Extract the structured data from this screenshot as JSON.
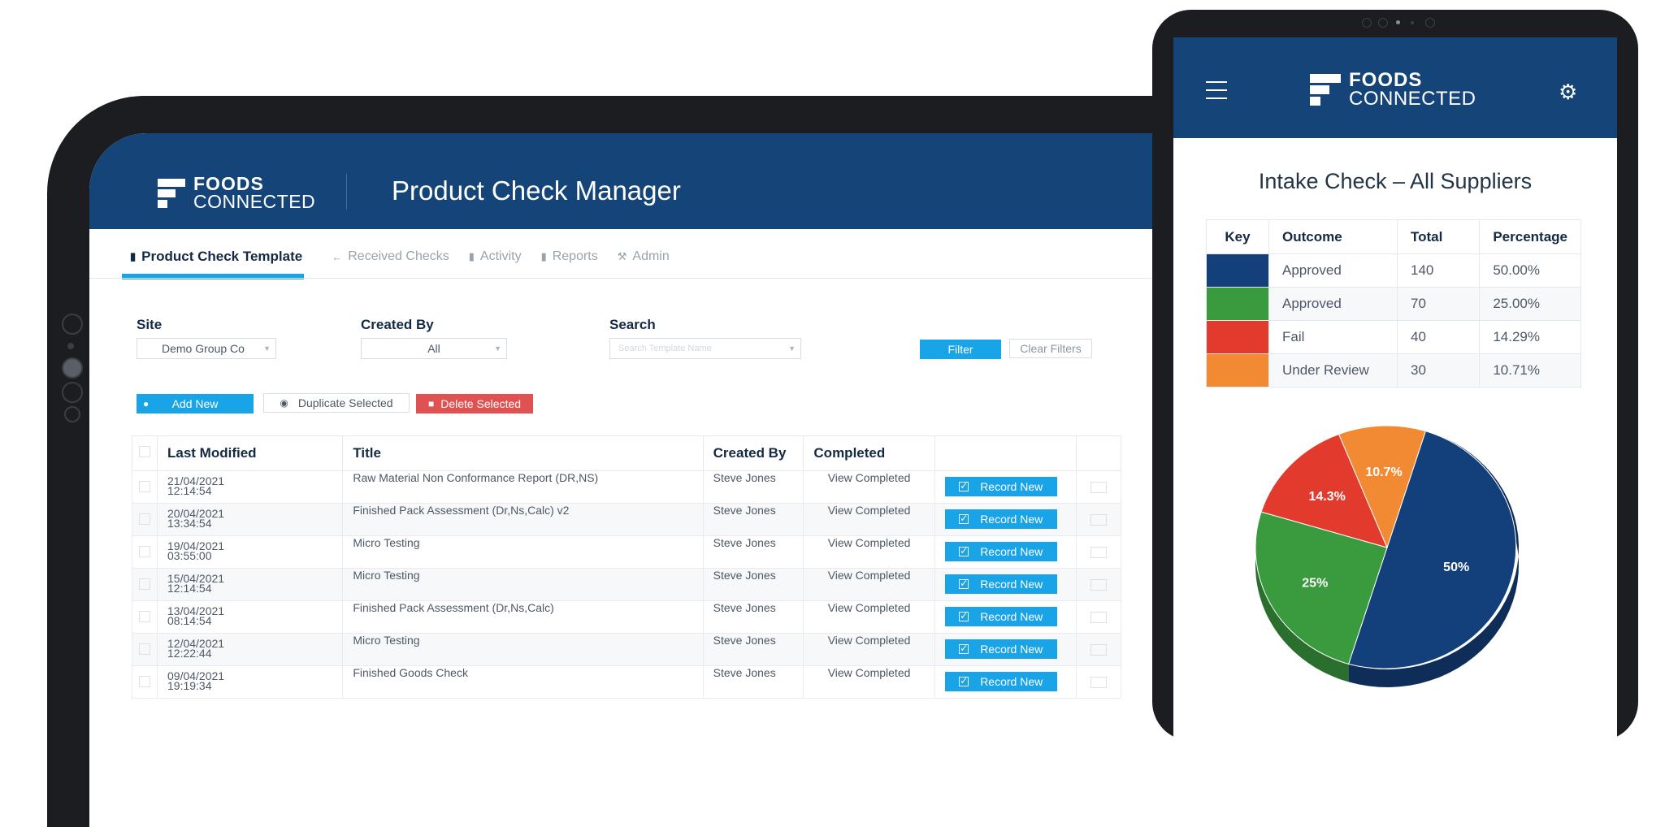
{
  "brand": {
    "line1": "FOODS",
    "line2": "CONNECTED"
  },
  "app": {
    "title": "Product Check Manager"
  },
  "tabs": [
    {
      "label": "Product Check Template",
      "icon": "document-icon",
      "active": true
    },
    {
      "label": "Received Checks",
      "icon": "arrow-left-icon"
    },
    {
      "label": "Activity",
      "icon": "document-icon"
    },
    {
      "label": "Reports",
      "icon": "document-icon"
    },
    {
      "label": "Admin",
      "icon": "wrench-icon"
    }
  ],
  "filters": {
    "site_label": "Site",
    "site_value": "Demo Group Co",
    "created_label": "Created By",
    "created_value": "All",
    "search_label": "Search",
    "search_placeholder": "Search Template Name",
    "filter_button": "Filter",
    "clear_button": "Clear Filters"
  },
  "actions": {
    "add": "Add New",
    "duplicate": "Duplicate Selected",
    "delete": "Delete Selected"
  },
  "table": {
    "headers": {
      "modified": "Last Modified",
      "title": "Title",
      "created_by": "Created By",
      "completed": "Completed"
    },
    "record_label": "Record New",
    "rows": [
      {
        "date": "21/04/2021",
        "time": "12:14:54",
        "title": "Raw Material Non Conformance Report (DR,NS)",
        "created_by": "Steve Jones",
        "completed": "View Completed"
      },
      {
        "date": "20/04/2021",
        "time": "13:34:54",
        "title": "Finished Pack Assessment (Dr,Ns,Calc) v2",
        "created_by": "Steve Jones",
        "completed": "View Completed"
      },
      {
        "date": "19/04/2021",
        "time": "03:55:00",
        "title": "Micro Testing",
        "created_by": "Steve Jones",
        "completed": "View Completed"
      },
      {
        "date": "15/04/2021",
        "time": "12:14:54",
        "title": "Micro Testing",
        "created_by": "Steve Jones",
        "completed": "View Completed"
      },
      {
        "date": "13/04/2021",
        "time": "08:14:54",
        "title": "Finished Pack Assessment (Dr,Ns,Calc)",
        "created_by": "Steve Jones",
        "completed": "View Completed"
      },
      {
        "date": "12/04/2021",
        "time": "12:22:44",
        "title": "Micro Testing",
        "created_by": "Steve Jones",
        "completed": "View Completed"
      },
      {
        "date": "09/04/2021",
        "time": "19:19:34",
        "title": "Finished Goods Check",
        "created_by": "Steve Jones",
        "completed": "View Completed"
      }
    ]
  },
  "phone": {
    "title": "Intake Check – All Suppliers",
    "headers": {
      "key": "Key",
      "outcome": "Outcome",
      "total": "Total",
      "percentage": "Percentage"
    },
    "rows": [
      {
        "color": "#133f7a",
        "outcome": "Approved",
        "total": "140",
        "percentage": "50.00%"
      },
      {
        "color": "#3a9a3e",
        "outcome": "Approved",
        "total": "70",
        "percentage": "25.00%"
      },
      {
        "color": "#e23a2c",
        "outcome": "Fail",
        "total": "40",
        "percentage": "14.29%"
      },
      {
        "color": "#f18a32",
        "outcome": "Under Review",
        "total": "30",
        "percentage": "10.71%"
      }
    ]
  },
  "chart_data": {
    "type": "pie",
    "values": [
      50,
      25,
      14.3,
      10.7
    ],
    "labels": [
      "50%",
      "25%",
      "14.3%",
      "10.7%"
    ],
    "colors": [
      "#133f7a",
      "#3a9a3e",
      "#e23a2c",
      "#f18a32"
    ]
  }
}
